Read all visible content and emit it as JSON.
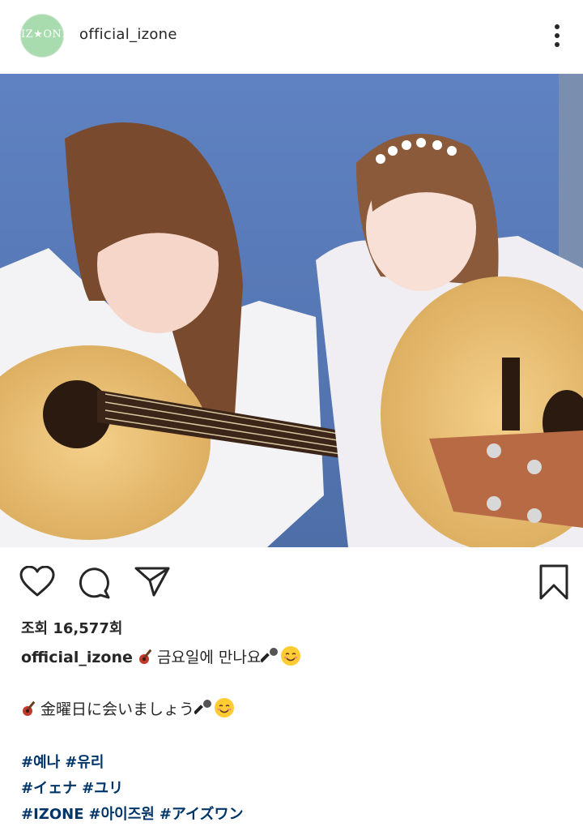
{
  "post": {
    "username": "official_izone",
    "avatar_text": "IZ★ONE",
    "views": "조회 16,577회",
    "caption_line1": "금요일에 만나요",
    "caption_line2": "金曜日に会いましょう",
    "hashtags_row1": [
      "#예나",
      "#유리"
    ],
    "hashtags_row2": [
      "#イェナ",
      "#ユリ"
    ],
    "hashtags_row3": [
      "#IZONE",
      "#아이즈원",
      "#アイズワン"
    ]
  },
  "icons": {
    "more": "more-vertical-icon",
    "like": "heart-icon",
    "comment": "comment-icon",
    "share": "paper-plane-icon",
    "save": "bookmark-icon",
    "guitar": "guitar-emoji",
    "microphone": "microphone-emoji",
    "smile": "smiling-face-emoji"
  },
  "colors": {
    "avatar_bg": "#a8dcae",
    "hashtag": "#003569",
    "text": "#262626"
  }
}
